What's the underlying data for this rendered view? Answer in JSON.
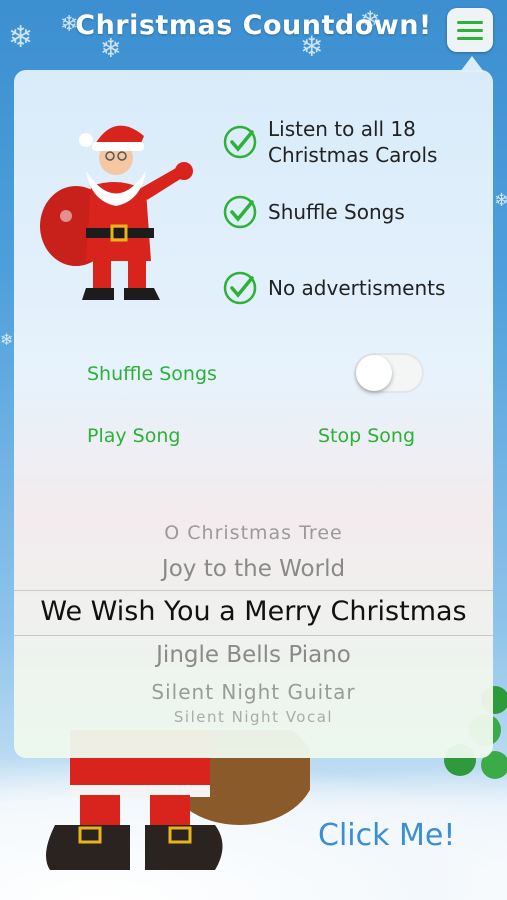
{
  "header": {
    "title": "Christmas Countdown!"
  },
  "features": [
    {
      "label_line1": "Listen to all 18",
      "label_line2": "Christmas Carols"
    },
    {
      "label_line1": "Shuffle Songs",
      "label_line2": ""
    },
    {
      "label_line1": "No advertisments",
      "label_line2": ""
    }
  ],
  "controls": {
    "shuffle_label": "Shuffle Songs",
    "shuffle_on": false,
    "play_label": "Play Song",
    "stop_label": "Stop Song"
  },
  "picker": {
    "items": [
      "O Christmas Tree",
      "Joy to the World",
      "We Wish You a Merry Christmas",
      "Jingle Bells Piano",
      "Silent Night Guitar",
      "Silent Night Vocal"
    ],
    "selected_index": 2
  },
  "footer": {
    "click_me": "Click Me!"
  },
  "colors": {
    "accent_green": "#2db136",
    "link_blue": "#3a8ed6",
    "sky_blue": "#3c8fd0"
  }
}
